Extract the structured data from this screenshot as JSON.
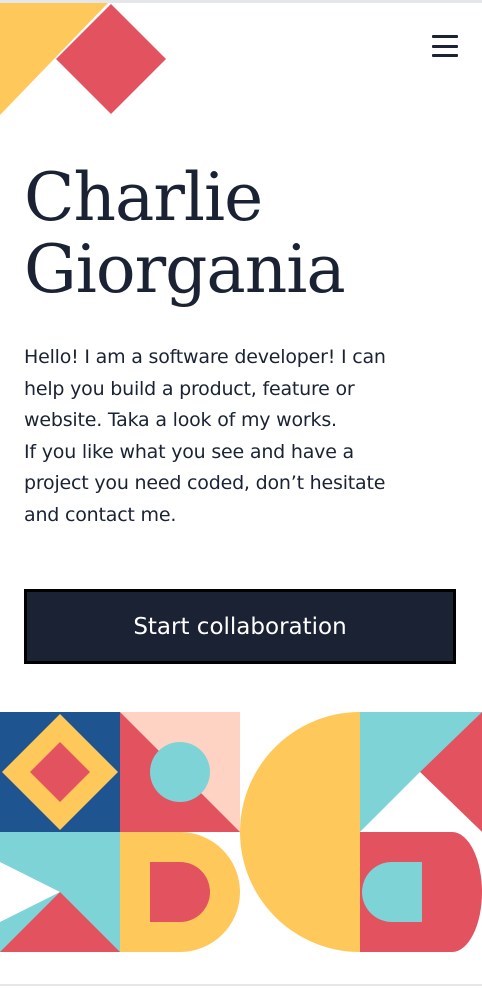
{
  "header": {
    "logo_icon": "geometric-logo-icon",
    "menu_icon": "hamburger-menu-icon"
  },
  "hero": {
    "name_line1": "Charlie",
    "name_line2": "Giorgania",
    "intro_lines": [
      "Hello! I am a software developer! I can",
      "help you build a product, feature or",
      "website. Taka a look of my works.",
      "If you like what you see and have a",
      "project you need coded, don’t hesitate",
      "and contact me."
    ],
    "cta_label": "Start collaboration"
  },
  "colors": {
    "navy": "#1a2233",
    "yellow": "#ffc85a",
    "red": "#e3525f",
    "teal": "#7ed3d6",
    "blue": "#1e5490",
    "peach": "#ffd3c4"
  }
}
